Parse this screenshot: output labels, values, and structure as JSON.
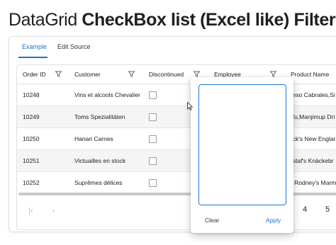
{
  "title": {
    "light": "DataGrid",
    "bold": "CheckBox list (Excel like) Filter"
  },
  "tabs": [
    {
      "label": "Example",
      "active": true
    },
    {
      "label": "Edit Source",
      "active": false
    }
  ],
  "grid": {
    "columns": [
      {
        "label": "Order ID",
        "filter": true
      },
      {
        "label": "Customer",
        "filter": true
      },
      {
        "label": "Discontinued",
        "filter": true
      },
      {
        "label": "Employee",
        "filter": true
      },
      {
        "label": "Product Name",
        "filter": false
      }
    ],
    "rows": [
      {
        "order_id": "10248",
        "customer": "Vins et alcools Chevalier",
        "discontinued": false,
        "product": "ueso Cabrales,Si"
      },
      {
        "order_id": "10249",
        "customer": "Toms Spezialitäten",
        "discontinued": false,
        "product": "ofu,Manjimup Dri"
      },
      {
        "order_id": "10250",
        "customer": "Hanari Carnes",
        "discontinued": false,
        "product": "ack's New Englar"
      },
      {
        "order_id": "10251",
        "customer": "Victuailles en stock",
        "discontinued": false,
        "product": "ustaf's Knäckebr"
      },
      {
        "order_id": "10252",
        "customer": "Suprêmes délices",
        "discontinued": false,
        "product": "ir Rodney's Marm"
      }
    ],
    "pager": {
      "first_icon": "first-page-icon",
      "prev_icon": "chevron-left-icon",
      "pages": [
        "4",
        "5"
      ]
    }
  },
  "filter_popup": {
    "clear_label": "Clear",
    "apply_label": "Apply"
  },
  "colors": {
    "accent": "#1976d2",
    "row_alt": "#f5f5f5",
    "border": "#e0e0e0"
  }
}
